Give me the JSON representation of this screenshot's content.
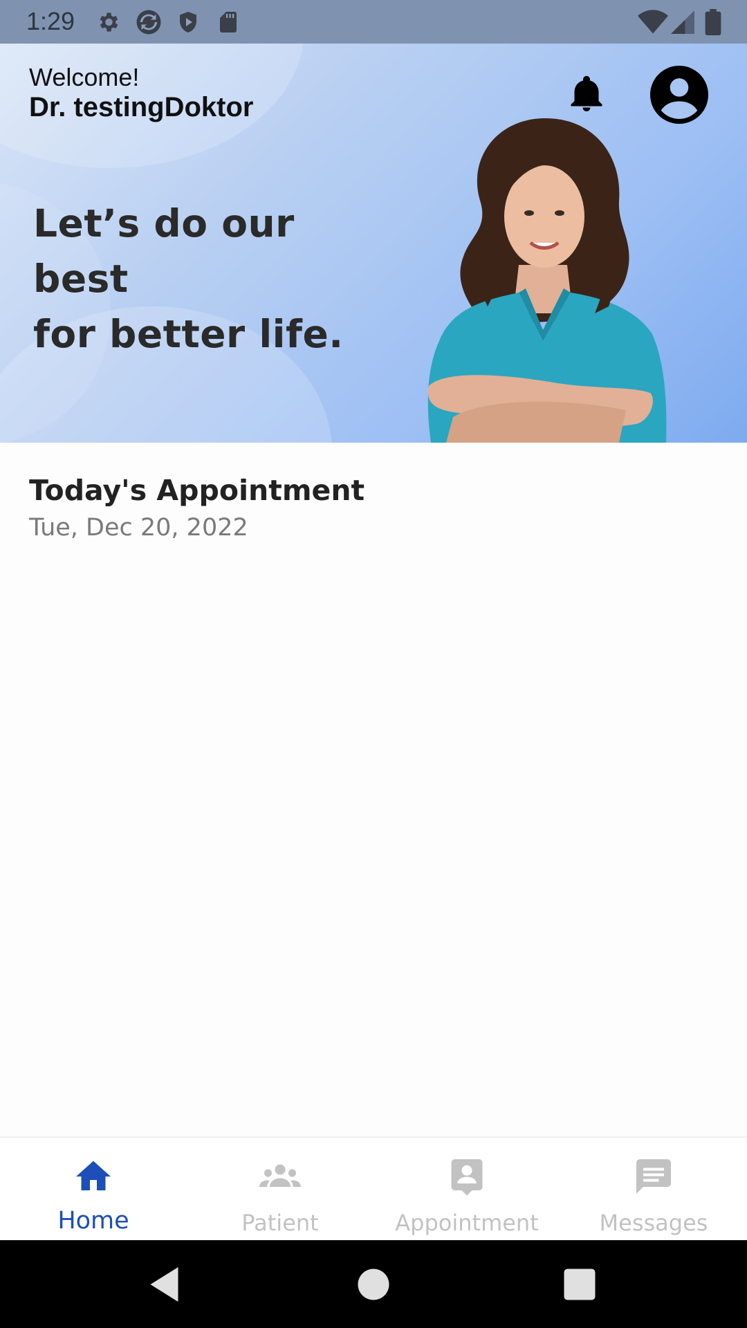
{
  "status_bar": {
    "time": "1:29",
    "icons": [
      "settings-icon",
      "sync-icon",
      "shield-icon",
      "sd-card-icon",
      "wifi-icon",
      "signal-icon",
      "battery-icon"
    ]
  },
  "header": {
    "welcome": "Welcome!",
    "user_name": "Dr. testingDoktor",
    "icons": [
      "bell-icon",
      "account-avatar-icon"
    ]
  },
  "banner": {
    "slogan_line1": "Let’s do our best",
    "slogan_line2": "for better life."
  },
  "appointments": {
    "title": "Today's Appointment",
    "date": "Tue, Dec 20, 2022"
  },
  "bottom_nav": {
    "items": [
      {
        "label": "Home",
        "icon": "home-icon",
        "active": true
      },
      {
        "label": "Patient",
        "icon": "group-icon",
        "active": false
      },
      {
        "label": "Appointment",
        "icon": "contact-card-icon",
        "active": false
      },
      {
        "label": "Messages",
        "icon": "message-icon",
        "active": false
      }
    ]
  },
  "colors": {
    "accent": "#1c4fb8",
    "inactive": "#c2c2c2",
    "status_bar": "#7f93b1",
    "banner_start": "#d9e5f7",
    "banner_end": "#7eabef",
    "scrubs": "#2aa6c0"
  }
}
